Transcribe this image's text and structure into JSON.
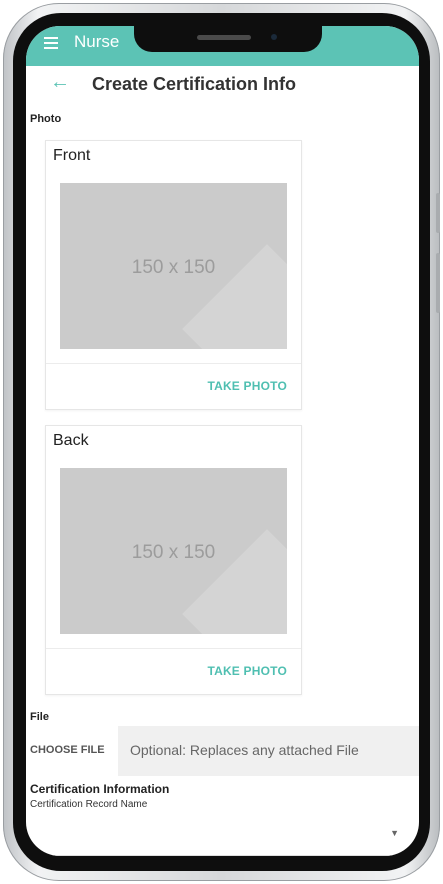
{
  "app_bar": {
    "title": "Nurse",
    "color": "#5cc3b5"
  },
  "header": {
    "back_icon": "arrow-left-icon",
    "title": "Create Certification Info"
  },
  "photo": {
    "section_label": "Photo",
    "cards": [
      {
        "title": "Front",
        "placeholder": "150 x 150",
        "action": "TAKE PHOTO"
      },
      {
        "title": "Back",
        "placeholder": "150 x 150",
        "action": "TAKE PHOTO"
      }
    ]
  },
  "file": {
    "section_label": "File",
    "button": "CHOOSE FILE",
    "placeholder": "Optional: Replaces any attached File"
  },
  "certification": {
    "heading": "Certification Information",
    "record_name_label": "Certification Record Name",
    "select_icon": "caret-down-icon"
  },
  "accent_color": "#4fbfb1"
}
